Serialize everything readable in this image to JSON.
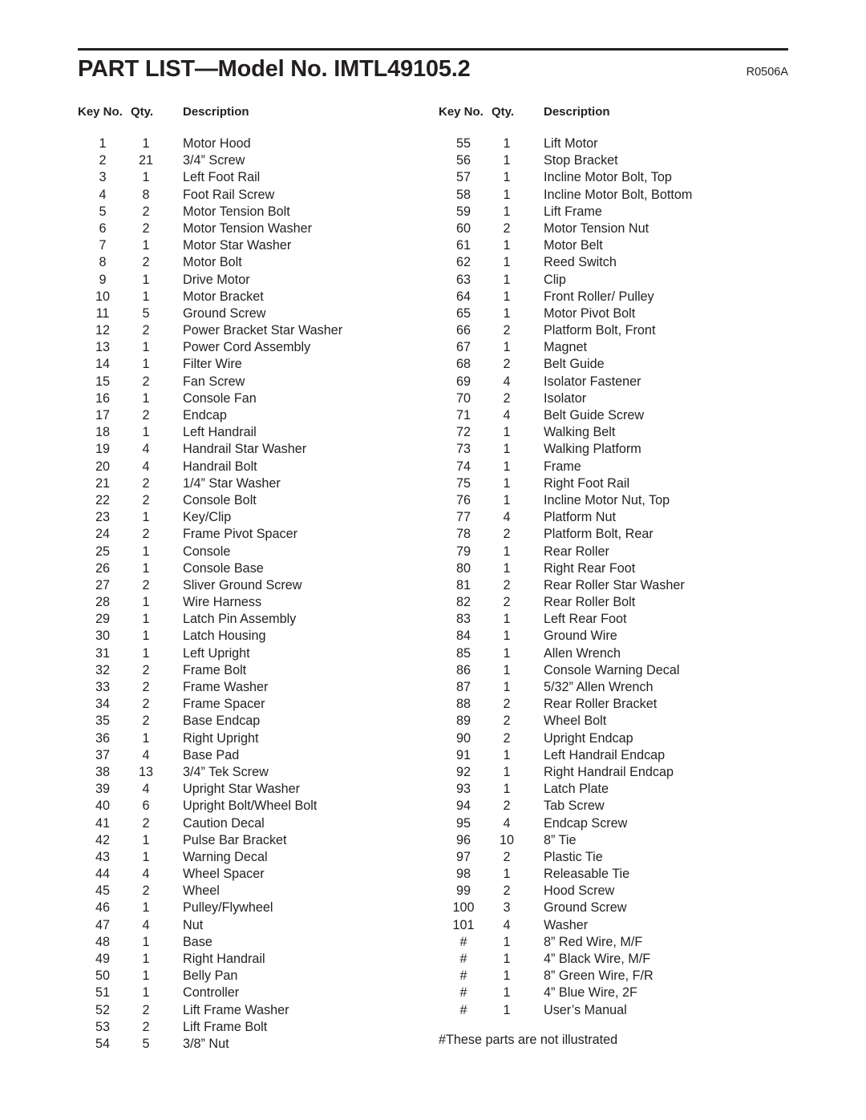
{
  "header": {
    "title": "PART LIST—Model No. IMTL49105.2",
    "revision": "R0506A"
  },
  "columns": {
    "headers": {
      "key": "Key No.",
      "qty": "Qty.",
      "desc": "Description"
    },
    "left": [
      {
        "key": "1",
        "qty": "1",
        "desc": "Motor Hood"
      },
      {
        "key": "2",
        "qty": "21",
        "desc": "3/4” Screw"
      },
      {
        "key": "3",
        "qty": "1",
        "desc": "Left Foot Rail"
      },
      {
        "key": "4",
        "qty": "8",
        "desc": "Foot Rail Screw"
      },
      {
        "key": "5",
        "qty": "2",
        "desc": "Motor Tension Bolt"
      },
      {
        "key": "6",
        "qty": "2",
        "desc": "Motor Tension Washer"
      },
      {
        "key": "7",
        "qty": "1",
        "desc": "Motor Star Washer"
      },
      {
        "key": "8",
        "qty": "2",
        "desc": "Motor Bolt"
      },
      {
        "key": "9",
        "qty": "1",
        "desc": "Drive Motor"
      },
      {
        "key": "10",
        "qty": "1",
        "desc": "Motor Bracket"
      },
      {
        "key": "11",
        "qty": "5",
        "desc": "Ground Screw"
      },
      {
        "key": "12",
        "qty": "2",
        "desc": "Power Bracket Star Washer"
      },
      {
        "key": "13",
        "qty": "1",
        "desc": "Power Cord Assembly"
      },
      {
        "key": "14",
        "qty": "1",
        "desc": "Filter Wire"
      },
      {
        "key": "15",
        "qty": "2",
        "desc": "Fan Screw"
      },
      {
        "key": "16",
        "qty": "1",
        "desc": "Console Fan"
      },
      {
        "key": "17",
        "qty": "2",
        "desc": "Endcap"
      },
      {
        "key": "18",
        "qty": "1",
        "desc": "Left Handrail"
      },
      {
        "key": "19",
        "qty": "4",
        "desc": "Handrail Star Washer"
      },
      {
        "key": "20",
        "qty": "4",
        "desc": "Handrail Bolt"
      },
      {
        "key": "21",
        "qty": "2",
        "desc": "1/4” Star Washer"
      },
      {
        "key": "22",
        "qty": "2",
        "desc": "Console Bolt"
      },
      {
        "key": "23",
        "qty": "1",
        "desc": "Key/Clip"
      },
      {
        "key": "24",
        "qty": "2",
        "desc": "Frame Pivot Spacer"
      },
      {
        "key": "25",
        "qty": "1",
        "desc": "Console"
      },
      {
        "key": "26",
        "qty": "1",
        "desc": "Console Base"
      },
      {
        "key": "27",
        "qty": "2",
        "desc": "Sliver Ground Screw"
      },
      {
        "key": "28",
        "qty": "1",
        "desc": "Wire Harness"
      },
      {
        "key": "29",
        "qty": "1",
        "desc": "Latch Pin Assembly"
      },
      {
        "key": "30",
        "qty": "1",
        "desc": "Latch Housing"
      },
      {
        "key": "31",
        "qty": "1",
        "desc": "Left Upright"
      },
      {
        "key": "32",
        "qty": "2",
        "desc": "Frame Bolt"
      },
      {
        "key": "33",
        "qty": "2",
        "desc": "Frame Washer"
      },
      {
        "key": "34",
        "qty": "2",
        "desc": "Frame Spacer"
      },
      {
        "key": "35",
        "qty": "2",
        "desc": "Base Endcap"
      },
      {
        "key": "36",
        "qty": "1",
        "desc": "Right Upright"
      },
      {
        "key": "37",
        "qty": "4",
        "desc": "Base Pad"
      },
      {
        "key": "38",
        "qty": "13",
        "desc": "3/4” Tek Screw"
      },
      {
        "key": "39",
        "qty": "4",
        "desc": "Upright Star Washer"
      },
      {
        "key": "40",
        "qty": "6",
        "desc": "Upright Bolt/Wheel Bolt"
      },
      {
        "key": "41",
        "qty": "2",
        "desc": "Caution Decal"
      },
      {
        "key": "42",
        "qty": "1",
        "desc": "Pulse Bar Bracket"
      },
      {
        "key": "43",
        "qty": "1",
        "desc": "Warning Decal"
      },
      {
        "key": "44",
        "qty": "4",
        "desc": "Wheel Spacer"
      },
      {
        "key": "45",
        "qty": "2",
        "desc": "Wheel"
      },
      {
        "key": "46",
        "qty": "1",
        "desc": "Pulley/Flywheel"
      },
      {
        "key": "47",
        "qty": "4",
        "desc": "Nut"
      },
      {
        "key": "48",
        "qty": "1",
        "desc": "Base"
      },
      {
        "key": "49",
        "qty": "1",
        "desc": "Right Handrail"
      },
      {
        "key": "50",
        "qty": "1",
        "desc": "Belly Pan"
      },
      {
        "key": "51",
        "qty": "1",
        "desc": "Controller"
      },
      {
        "key": "52",
        "qty": "2",
        "desc": "Lift Frame Washer"
      },
      {
        "key": "53",
        "qty": "2",
        "desc": "Lift Frame Bolt"
      },
      {
        "key": "54",
        "qty": "5",
        "desc": "3/8” Nut"
      }
    ],
    "right": [
      {
        "key": "55",
        "qty": "1",
        "desc": "Lift Motor"
      },
      {
        "key": "56",
        "qty": "1",
        "desc": "Stop Bracket"
      },
      {
        "key": "57",
        "qty": "1",
        "desc": "Incline Motor Bolt, Top"
      },
      {
        "key": "58",
        "qty": "1",
        "desc": "Incline Motor Bolt, Bottom"
      },
      {
        "key": "59",
        "qty": "1",
        "desc": "Lift Frame"
      },
      {
        "key": "60",
        "qty": "2",
        "desc": "Motor Tension Nut"
      },
      {
        "key": "61",
        "qty": "1",
        "desc": "Motor Belt"
      },
      {
        "key": "62",
        "qty": "1",
        "desc": "Reed Switch"
      },
      {
        "key": "63",
        "qty": "1",
        "desc": "Clip"
      },
      {
        "key": "64",
        "qty": "1",
        "desc": "Front Roller/ Pulley"
      },
      {
        "key": "65",
        "qty": "1",
        "desc": "Motor Pivot Bolt"
      },
      {
        "key": "66",
        "qty": "2",
        "desc": "Platform Bolt, Front"
      },
      {
        "key": "67",
        "qty": "1",
        "desc": "Magnet"
      },
      {
        "key": "68",
        "qty": "2",
        "desc": "Belt Guide"
      },
      {
        "key": "69",
        "qty": "4",
        "desc": "Isolator Fastener"
      },
      {
        "key": "70",
        "qty": "2",
        "desc": "Isolator"
      },
      {
        "key": "71",
        "qty": "4",
        "desc": "Belt Guide Screw"
      },
      {
        "key": "72",
        "qty": "1",
        "desc": "Walking Belt"
      },
      {
        "key": "73",
        "qty": "1",
        "desc": "Walking Platform"
      },
      {
        "key": "74",
        "qty": "1",
        "desc": "Frame"
      },
      {
        "key": "75",
        "qty": "1",
        "desc": "Right Foot Rail"
      },
      {
        "key": "76",
        "qty": "1",
        "desc": "Incline Motor Nut, Top"
      },
      {
        "key": "77",
        "qty": "4",
        "desc": "Platform Nut"
      },
      {
        "key": "78",
        "qty": "2",
        "desc": "Platform Bolt, Rear"
      },
      {
        "key": "79",
        "qty": "1",
        "desc": "Rear Roller"
      },
      {
        "key": "80",
        "qty": "1",
        "desc": "Right Rear Foot"
      },
      {
        "key": "81",
        "qty": "2",
        "desc": "Rear Roller Star Washer"
      },
      {
        "key": "82",
        "qty": "2",
        "desc": "Rear Roller Bolt"
      },
      {
        "key": "83",
        "qty": "1",
        "desc": "Left Rear Foot"
      },
      {
        "key": "84",
        "qty": "1",
        "desc": "Ground Wire"
      },
      {
        "key": "85",
        "qty": "1",
        "desc": "Allen Wrench"
      },
      {
        "key": "86",
        "qty": "1",
        "desc": "Console Warning Decal"
      },
      {
        "key": "87",
        "qty": "1",
        "desc": "5/32” Allen Wrench"
      },
      {
        "key": "88",
        "qty": "2",
        "desc": "Rear Roller Bracket"
      },
      {
        "key": "89",
        "qty": "2",
        "desc": "Wheel Bolt"
      },
      {
        "key": "90",
        "qty": "2",
        "desc": "Upright Endcap"
      },
      {
        "key": "91",
        "qty": "1",
        "desc": "Left Handrail Endcap"
      },
      {
        "key": "92",
        "qty": "1",
        "desc": "Right Handrail Endcap"
      },
      {
        "key": "93",
        "qty": "1",
        "desc": "Latch Plate"
      },
      {
        "key": "94",
        "qty": "2",
        "desc": "Tab Screw"
      },
      {
        "key": "95",
        "qty": "4",
        "desc": "Endcap Screw"
      },
      {
        "key": "96",
        "qty": "10",
        "desc": "8” Tie"
      },
      {
        "key": "97",
        "qty": "2",
        "desc": "Plastic Tie"
      },
      {
        "key": "98",
        "qty": "1",
        "desc": "Releasable Tie"
      },
      {
        "key": "99",
        "qty": "2",
        "desc": "Hood Screw"
      },
      {
        "key": "100",
        "qty": "3",
        "desc": "Ground Screw"
      },
      {
        "key": "101",
        "qty": "4",
        "desc": "Washer"
      },
      {
        "key": "#",
        "qty": "1",
        "desc": "8” Red Wire, M/F"
      },
      {
        "key": "#",
        "qty": "1",
        "desc": "4” Black Wire, M/F"
      },
      {
        "key": "#",
        "qty": "1",
        "desc": "8” Green Wire, F/R"
      },
      {
        "key": "#",
        "qty": "1",
        "desc": "4” Blue Wire, 2F"
      },
      {
        "key": "#",
        "qty": "1",
        "desc": "User’s Manual"
      }
    ]
  },
  "footnote": "#These parts are not illustrated"
}
